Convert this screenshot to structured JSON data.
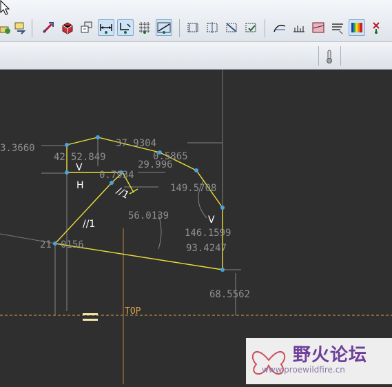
{
  "toolbar": {
    "tools": [
      {
        "name": "sketch-display-icon"
      },
      {
        "name": "view-orient-icon"
      },
      {
        "name": "repaint-icon"
      },
      {
        "name": "shade-icon"
      },
      {
        "name": "saved-view-icon"
      },
      {
        "name": "dimension-display-icon",
        "active": true
      },
      {
        "name": "constraint-display-icon",
        "active": true
      },
      {
        "name": "grid-display-icon"
      },
      {
        "name": "vertex-display-icon",
        "active": true
      },
      {
        "name": "datum-plane-icon"
      },
      {
        "name": "datum-axis-icon"
      },
      {
        "name": "datum-point-icon"
      },
      {
        "name": "datum-csys-icon"
      },
      {
        "name": "analysis-curvature-icon"
      },
      {
        "name": "analysis-section-icon"
      },
      {
        "name": "analysis-color-icon"
      },
      {
        "name": "overlap-icon"
      },
      {
        "name": "spectrum-icon",
        "active": true
      },
      {
        "name": "close-sketch-icon"
      }
    ]
  },
  "sketch": {
    "dimensions": [
      "3.3660",
      "42",
      "52.849",
      "37.9304",
      "29.996",
      "0.5865",
      "0.7934",
      "149.5708",
      "56.0139",
      "146.1599",
      "93.4247",
      "21",
      "0156",
      "68.5562"
    ],
    "constraints": [
      "V",
      "H",
      "//1",
      "//1",
      "V"
    ],
    "reference_label": "TOP"
  },
  "watermark": {
    "title": "野火论坛",
    "url": "www.proewildfire.cn"
  },
  "colors": {
    "canvas_bg": "#2f2f2f",
    "geometry": "#e8e03a",
    "vertex": "#4aa3e0",
    "dimension": "#8f8f8f",
    "reference": "#d9a24a",
    "watermark": "#6d3f98"
  }
}
